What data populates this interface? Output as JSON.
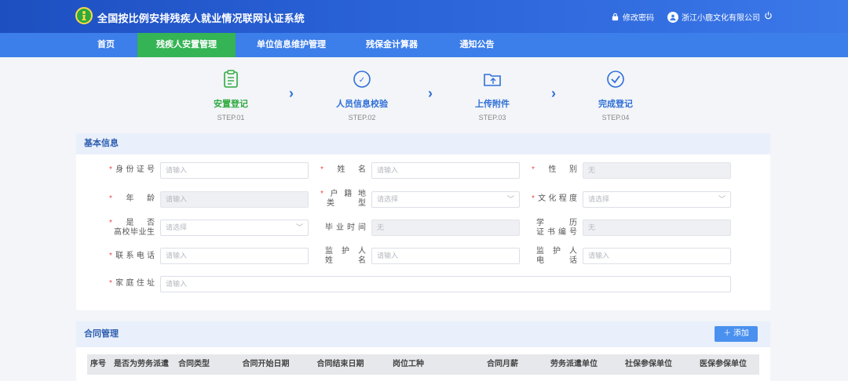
{
  "header": {
    "title": "全国按比例安排残疾人就业情况联网认证系统",
    "change_password": "修改密码",
    "company": "浙江小鹿文化有限公司"
  },
  "nav": {
    "items": [
      {
        "label": "首页"
      },
      {
        "label": "残疾人安置管理"
      },
      {
        "label": "单位信息维护管理"
      },
      {
        "label": "残保金计算器"
      },
      {
        "label": "通知公告"
      }
    ],
    "active_index": 1
  },
  "steps": [
    {
      "label": "安置登记",
      "sub": "STEP.01",
      "icon": "clipboard-icon",
      "active": true
    },
    {
      "label": "人员信息校验",
      "sub": "STEP.02",
      "icon": "verify-icon"
    },
    {
      "label": "上传附件",
      "sub": "STEP.03",
      "icon": "upload-folder-icon"
    },
    {
      "label": "完成登记",
      "sub": "STEP.04",
      "icon": "check-circle-icon"
    }
  ],
  "basic_info": {
    "title": "基本信息",
    "fields": {
      "id_number": {
        "label": "身份证号",
        "placeholder": "请输入"
      },
      "name": {
        "label": "姓名",
        "placeholder": "请输入"
      },
      "gender": {
        "label": "性别",
        "placeholder": "无"
      },
      "age": {
        "label": "年龄",
        "placeholder": "请输入"
      },
      "hukou_l1": {
        "label": "户籍地"
      },
      "hukou_l2": {
        "label": "类型"
      },
      "hukou": {
        "placeholder": "请选择"
      },
      "education": {
        "label": "文化程度",
        "placeholder": "请选择"
      },
      "graduate_l1": {
        "label": "是否"
      },
      "graduate_l2": {
        "label": "高校毕业生"
      },
      "graduate": {
        "placeholder": "请选择"
      },
      "grad_time": {
        "label": "毕业时间",
        "placeholder": "无"
      },
      "degree_l1": {
        "label": "学历"
      },
      "degree_l2": {
        "label": "证书编号"
      },
      "degree": {
        "placeholder": "无"
      },
      "phone": {
        "label": "联系电话",
        "placeholder": "请输入"
      },
      "guardian_l1": {
        "label": "监护人"
      },
      "guardian_l2": {
        "label": "姓名"
      },
      "guardian_name": {
        "placeholder": "请输入"
      },
      "gphone_l1": {
        "label": "监护人"
      },
      "gphone_l2": {
        "label": "电话"
      },
      "guardian_phone": {
        "placeholder": "请输入"
      },
      "address": {
        "label": "家庭住址",
        "placeholder": "请输入"
      }
    }
  },
  "contract": {
    "title": "合同管理",
    "add_label": "添加",
    "columns": [
      "序号",
      "是否为劳务派遣",
      "合同类型",
      "合同开始日期",
      "合同结束日期",
      "岗位工种",
      "合同月薪",
      "劳务派遣单位",
      "社保参保单位",
      "医保参保单位"
    ]
  },
  "colors": {
    "primary": "#3c7eea",
    "active_nav": "#34b454",
    "step_active": "#2eaa3f",
    "required": "#e84a4a"
  }
}
